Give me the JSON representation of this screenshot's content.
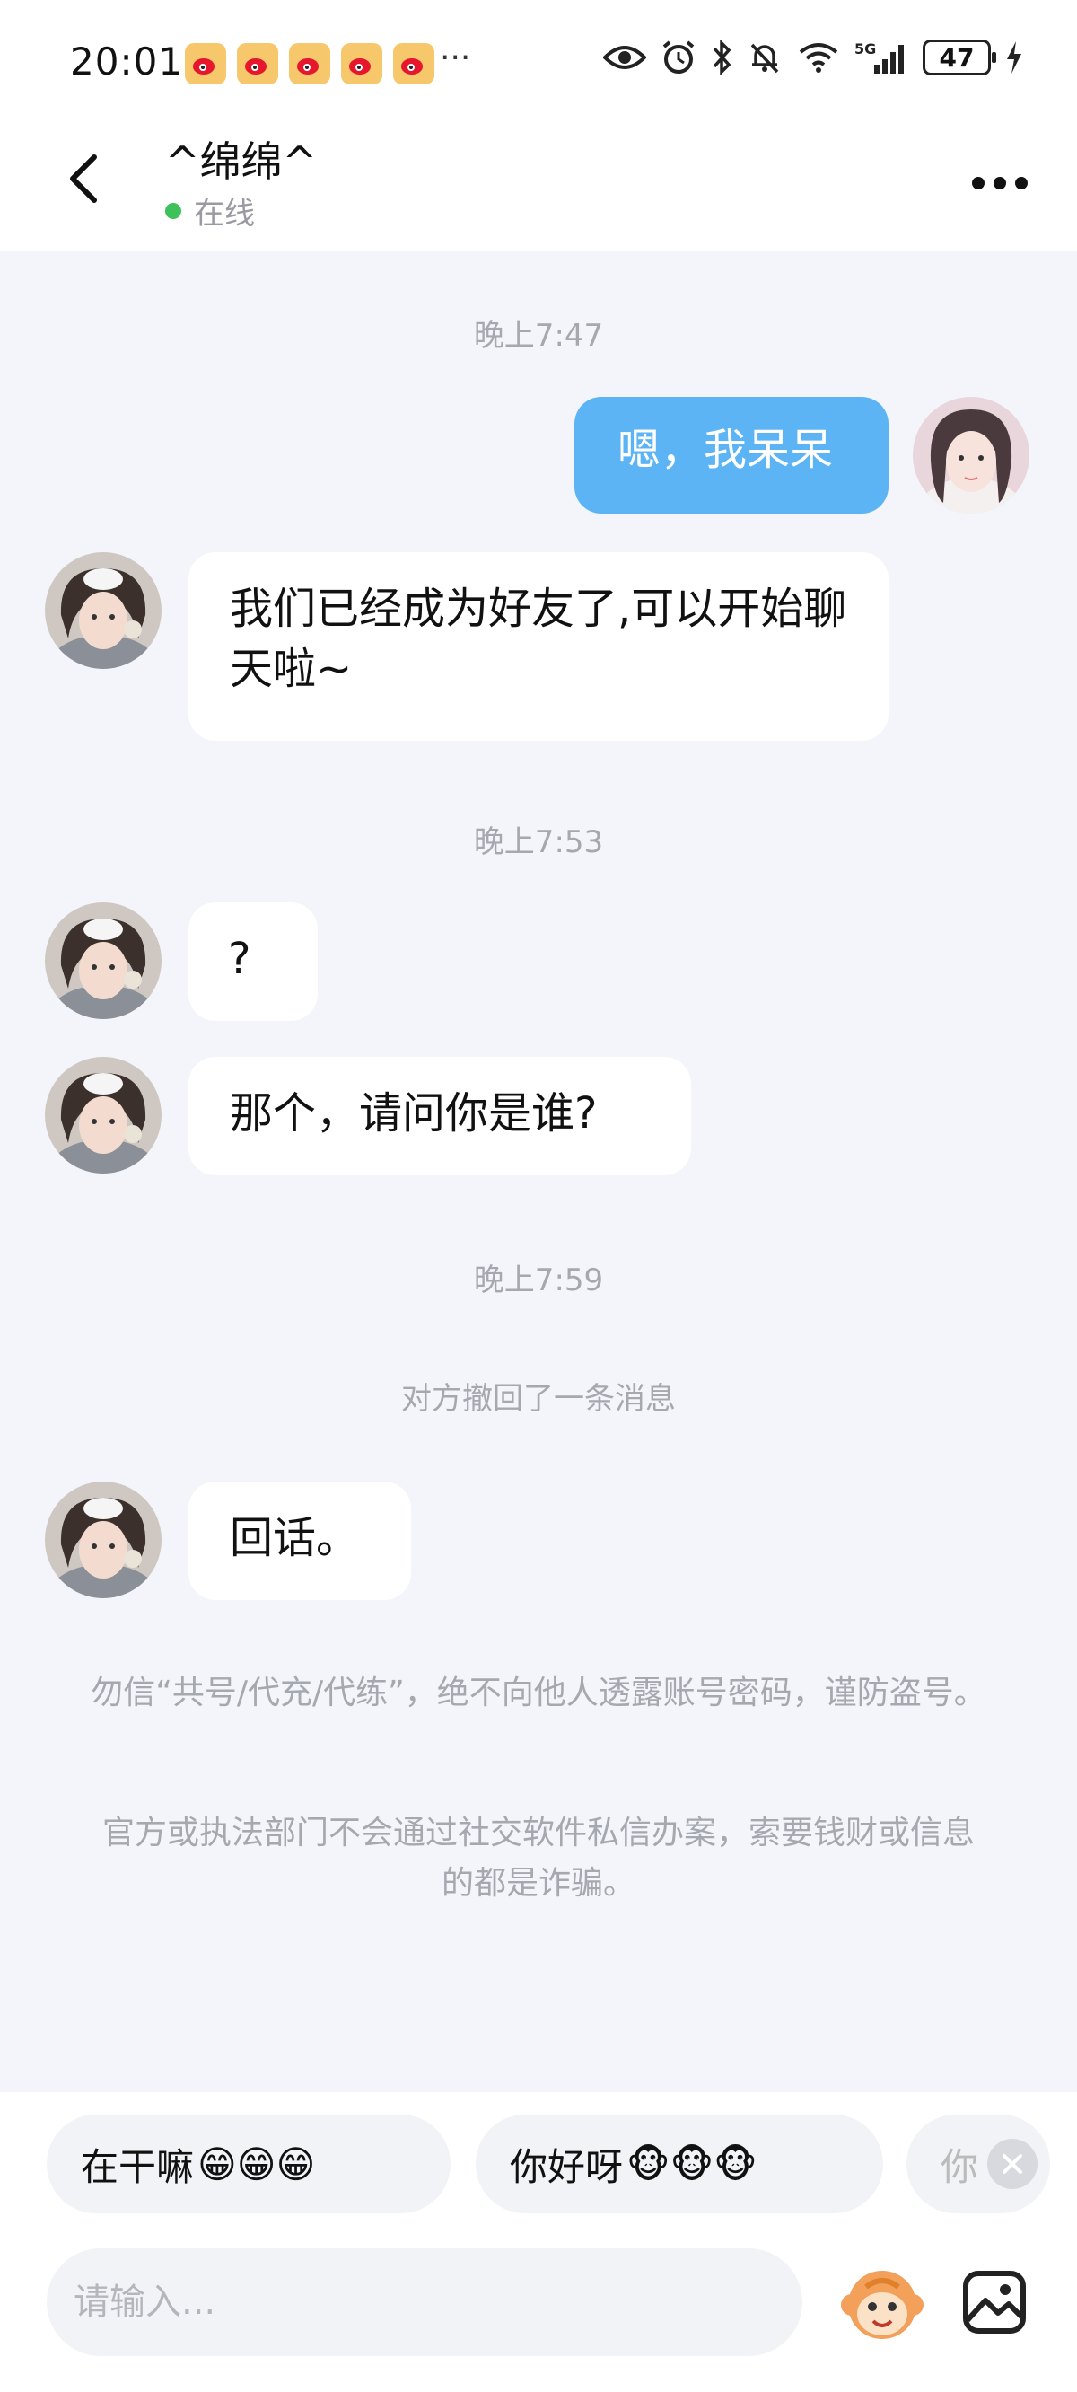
{
  "status_bar": {
    "time": "20:01",
    "app_icons": [
      "weibo-icon",
      "weibo-icon",
      "weibo-icon",
      "weibo-icon",
      "weibo-icon"
    ],
    "more": "···",
    "signal_label": "5G",
    "battery": "47"
  },
  "header": {
    "contact_name": "^绵绵^",
    "status": "在线",
    "status_color": "#3ec05a"
  },
  "chat": {
    "timestamps": [
      "晚上7:47",
      "晚上7:53",
      "晚上7:59"
    ],
    "messages": [
      {
        "side": "out",
        "text": "嗯，我呆呆"
      },
      {
        "side": "in",
        "text": "我们已经成为好友了,可以开始聊天啦~"
      },
      {
        "side": "in",
        "text": "?"
      },
      {
        "side": "in",
        "text": "那个，请问你是谁?"
      },
      {
        "side": "in",
        "text": "回话。"
      }
    ],
    "recall_notice": "对方撤回了一条消息",
    "safety_tips": [
      "勿信“共号/代充/代练”，绝不向他人透露账号密码，谨防盗号。",
      "官方或执法部门不会通过社交软件私信办案，索要钱财或信息的都是诈骗。"
    ]
  },
  "quick_replies": [
    {
      "text": "在干嘛",
      "emoji": "😁😁😁"
    },
    {
      "text": "你好呀",
      "emoji": "🐵🐵🐵"
    },
    {
      "text": "你",
      "emoji": ""
    }
  ],
  "input": {
    "placeholder": "请输入..."
  },
  "colors": {
    "outgoing_bubble": "#5cb4f5",
    "incoming_bubble": "#ffffff",
    "background": "#f3f5fa"
  }
}
